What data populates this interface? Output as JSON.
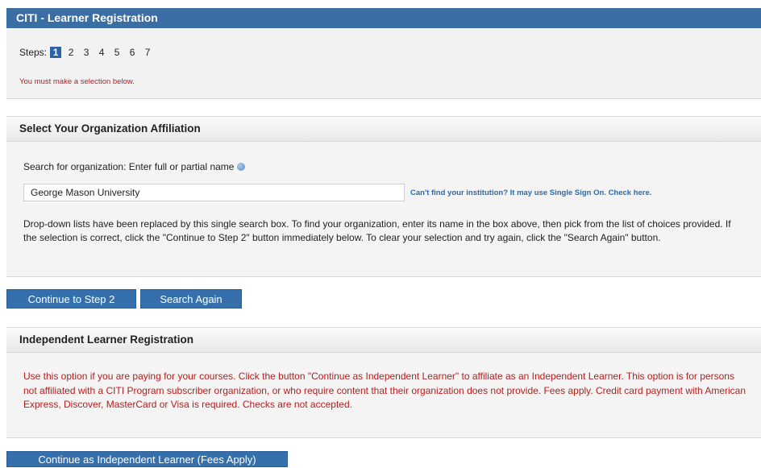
{
  "header": {
    "title": "CITI - Learner Registration"
  },
  "steps": {
    "label": "Steps:",
    "items": [
      "1",
      "2",
      "3",
      "4",
      "5",
      "6",
      "7"
    ],
    "active_index": 0,
    "warning": "You must make a selection below."
  },
  "org": {
    "heading": "Select Your Organization Affiliation",
    "search_label": "Search for organization: Enter full or partial name",
    "search_value": "George Mason University",
    "sso_link": "Can't find your institution? It may use Single Sign On. Check here.",
    "instructions": "Drop-down lists have been replaced by this single search box. To find your organization, enter its name in the box above, then pick from the list of choices provided. If the selection is correct, click the \"Continue to Step 2\" button immediately below. To clear your selection and try again, click the \"Search Again\" button.",
    "continue_button": "Continue to Step 2",
    "search_again_button": "Search Again"
  },
  "independent": {
    "heading": "Independent Learner Registration",
    "text": "Use this option if you are paying for your courses. Click the button \"Continue as Independent Learner\" to affiliate as an Independent Learner. This option is for persons not affiliated with a CITI Program subscriber organization, or who require content that their organization does not provide. Fees apply. Credit card payment with American Express, Discover, MasterCard or Visa is required. Checks are not accepted.",
    "button": "Continue as Independent Learner (Fees Apply)"
  },
  "colors": {
    "header_bg": "#3a6ea5",
    "button_bg": "#3570ad",
    "warning_text": "#b41e1e",
    "link": "#2a6bb0"
  }
}
